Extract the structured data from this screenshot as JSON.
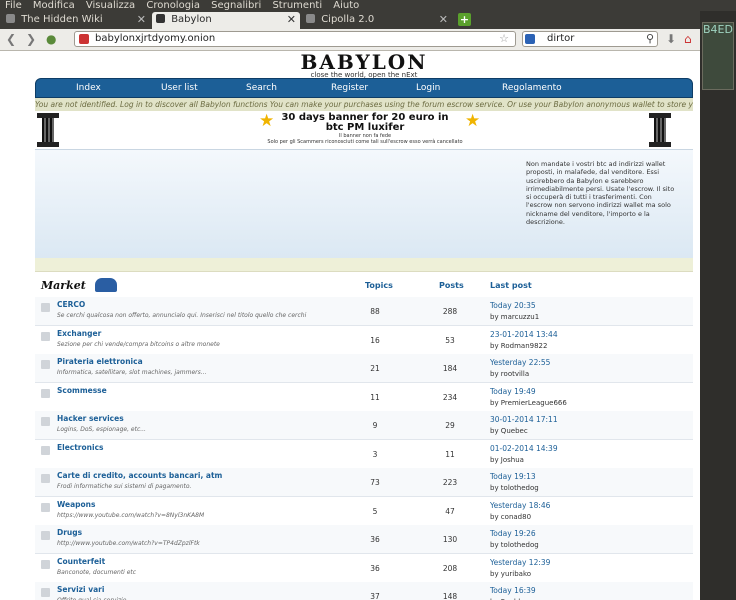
{
  "menubar": {
    "items": [
      "File",
      "Modifica",
      "Visualizza",
      "Cronologia",
      "Segnalibri",
      "Strumenti",
      "Aiuto"
    ]
  },
  "tabs": [
    {
      "label": "The Hidden Wiki",
      "active": false
    },
    {
      "label": "Babylon",
      "active": true
    },
    {
      "label": "Cipolla 2.0",
      "active": false
    }
  ],
  "newtab": "+",
  "nav": {
    "back_icon": "arrow-left-icon",
    "forward_icon": "arrow-right-icon",
    "url": "babylonxjrtdyomy.onion",
    "search_query": "dirtor"
  },
  "sidepanel": {
    "text": "B4ED"
  },
  "site": {
    "logo_text": "BABYLON",
    "logo_tagline": "close the world, open the nExt",
    "menu": [
      "Index",
      "User list",
      "Search",
      "Register",
      "Login",
      "Regolamento"
    ],
    "notice": "You are not identified. Log in to discover all Babylon functions You can make your purchases using the forum escrow service. Or use your Babylon anonymous wallet to store your coins.",
    "banner_title": "30 days banner for 20 euro in btc PM luxifer",
    "banner_note1": "Il banner non fa fede",
    "banner_note2": "Solo per gli Scammers riconosciuti come tali sull'escrow esso verrà cancellato",
    "info_text": "Non mandate i vostri btc ad indirizzi wallet proposti, in malafede, dal venditore. Essi uscirebbero da Babylon e sarebbero irrimediabilmente persi. Usate l'escrow. Il sito si occuperà di tutti i trasferimenti. Con l'escrow non servono indirizzi wallet ma solo nickname del venditore, l'importo e la descrizione."
  },
  "market": {
    "title": "Market",
    "col_topics": "Topics",
    "col_posts": "Posts",
    "col_last": "Last post",
    "forums": [
      {
        "name": "CERCO",
        "desc": "Se cerchi qualcosa non offerto, annuncialo qui. Inserisci nel titolo quello che cerchi",
        "topics": "88",
        "posts": "288",
        "date": "Today 20:35",
        "by": "by marcuzzu1"
      },
      {
        "name": "Exchanger",
        "desc": "Sezione per chi vende/compra bitcoins o altre monete",
        "topics": "16",
        "posts": "53",
        "date": "23-01-2014 13:44",
        "by": "by Rodman9822"
      },
      {
        "name": "Pirateria elettronica",
        "desc": "Informatica, satellitare, slot machines, jammers...",
        "topics": "21",
        "posts": "184",
        "date": "Yesterday 22:55",
        "by": "by rootvilla"
      },
      {
        "name": "Scommesse",
        "desc": "",
        "topics": "11",
        "posts": "234",
        "date": "Today 19:49",
        "by": "by PremierLeague666"
      },
      {
        "name": "Hacker services",
        "desc": "Logins, DoS, espionage, etc...",
        "topics": "9",
        "posts": "29",
        "date": "30-01-2014 17:11",
        "by": "by Quebec"
      },
      {
        "name": "Electronics",
        "desc": "",
        "topics": "3",
        "posts": "11",
        "date": "01-02-2014 14:39",
        "by": "by Joshua"
      },
      {
        "name": "Carte di credito, accounts bancari, atm",
        "desc": "Frodi informatiche sui sistemi di pagamento.",
        "topics": "73",
        "posts": "223",
        "date": "Today 19:13",
        "by": "by tolothedog"
      },
      {
        "name": "Weapons",
        "desc": "https://www.youtube.com/watch?v=8Nyl3nKA8M",
        "topics": "5",
        "posts": "47",
        "date": "Yesterday 18:46",
        "by": "by conad80"
      },
      {
        "name": "Drugs",
        "desc": "http://www.youtube.com/watch?v=TP4dZpzlFtk",
        "topics": "36",
        "posts": "130",
        "date": "Today 19:26",
        "by": "by tolothedog"
      },
      {
        "name": "Counterfeit",
        "desc": "Banconote, documenti etc",
        "topics": "36",
        "posts": "208",
        "date": "Yesterday 12:39",
        "by": "by yuribako"
      },
      {
        "name": "Servizi vari",
        "desc": "Offrite qual sia servizio",
        "topics": "37",
        "posts": "148",
        "date": "Today 16:39",
        "by": "by Freddo"
      }
    ]
  },
  "colors": {
    "accent": "#1c5f97",
    "notice_bg": "#e1e3c8"
  }
}
